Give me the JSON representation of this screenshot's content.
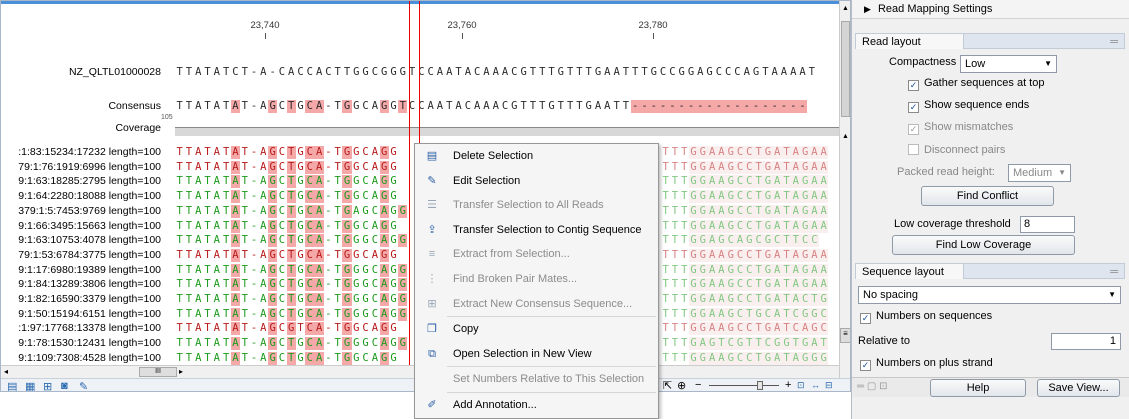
{
  "ruler": {
    "ticks": [
      "23,740",
      "23,760",
      "23,780"
    ]
  },
  "reference": {
    "name": "NZ_QLTL01000028",
    "bases": "TTATATCT-A-CACCACTTGGCGGGTCCAATACAAACGTTTGTTTGAATTTGCCGGAGCCCAGTAAAAT"
  },
  "consensus": {
    "label": "Consensus",
    "bases": "TTATATAT-AGCTGCA-TGGCAGGTCCAATACAAACGTTTGTTTGAATT-------------------"
  },
  "coverage": {
    "label": "Coverage",
    "max": "105"
  },
  "reads": [
    {
      "name": ":1:83:15234:17232 length=100",
      "left": "TTATATAT-AGCTGCA-TGGCAGG",
      "right": "TTTGGAAGCCTGATAGAA",
      "color": "#b81b1b"
    },
    {
      "name": "79:1:76:1919:6996 length=100",
      "left": "TTATATAT-AGCTGCA-TGGCAGG",
      "right": "TTTGGAAGCCTGATAGAA",
      "color": "#b81b1b"
    },
    {
      "name": "9:1:63:18285:2795 length=100",
      "left": "TTATATAT-AGCTGCA-TGGCAGG",
      "right": "TTTGGAAGCCTGATAGAA",
      "color": "#1c9b1c"
    },
    {
      "name": "9:1:64:2280:18088 length=100",
      "left": "TTATATAT-AGCTGCA-TGGCAGG",
      "right": "TTTGGAAGCCTGATAGAA",
      "color": "#1c9b1c"
    },
    {
      "name": "379:1:5:7453:9769 length=100",
      "left": "TTATATAT-AGCTGCA-TGAGCAGG",
      "right": "TTTGGAAGCCTGATAGAA",
      "color": "#1c9b1c"
    },
    {
      "name": "9:1:66:3495:15663 length=100",
      "left": "TTATATAT-AGCTGCA-TGGCAGG",
      "right": "TTTGGAAGCCTGATAGAA",
      "color": "#1c9b1c"
    },
    {
      "name": "9:1:63:10753:4078 length=100",
      "left": "TTATATAT-AGCTGCA-TGGGCAGG",
      "right": "TTTGGAGCAGCGCTTCC",
      "color": "#1c9b1c"
    },
    {
      "name": "79:1:53:6784:3775 length=100",
      "left": "TTATATAT-AGCTGCA-TGGCAGG",
      "right": "TTTGGAAGCCTGATAGAA",
      "color": "#b81b1b"
    },
    {
      "name": "9:1:17:6980:19389 length=100",
      "left": "TTATATAT-AGCTGCA-TGGGCAGG",
      "right": "TTTGGAAGCCTGATAGAA",
      "color": "#1c9b1c"
    },
    {
      "name": "9:1:84:13289:3806 length=100",
      "left": "TTATATAT-AGCTGCA-TGGGCAGG",
      "right": "TTTGGAAGCCTGATAGAA",
      "color": "#1c9b1c"
    },
    {
      "name": "9:1:82:16590:3379 length=100",
      "left": "TTATATAT-AGCTGCA-TGGGCAGG",
      "right": "TTTGGAAGCCTGATACTG",
      "color": "#1c9b1c"
    },
    {
      "name": "9:1:50:15194:6151 length=100",
      "left": "TTATATAT-AGCTGCA-TGGGCAGG",
      "right": "TTTGGAAGCTGCATCGGC",
      "color": "#1c9b1c"
    },
    {
      "name": ":1:97:17768:13378 length=100",
      "left": "TTATATAT-AGCGTCA-TGGCAGG",
      "right": "TTTGGAAGCCTGATCAGC",
      "color": "#b81b1b"
    },
    {
      "name": "9:1:78:1530:12431 length=100",
      "left": "TTATATAT-AGCTGCA-TGGGCAGG",
      "right": "TTTGAGTCGTTCGGTGAT",
      "color": "#1c9b1c"
    },
    {
      "name": "9:1:109:7308:4528 length=100",
      "left": "TTATATAT-AGCTGCA-TGGCAGG",
      "right": "TTTGGAAGCCTGATAGGG",
      "color": "#1c9b1c"
    }
  ],
  "context_menu": [
    {
      "label": "Delete Selection",
      "icon": "delete-selection-icon",
      "glyph": "▤",
      "enabled": true
    },
    {
      "label": "Edit Selection",
      "icon": "edit-pencil-icon",
      "glyph": "✎",
      "enabled": true
    },
    {
      "label": "Transfer Selection to All Reads",
      "icon": "transfer-all-icon",
      "glyph": "☰",
      "enabled": false
    },
    {
      "label": "Transfer Selection to Contig Sequence",
      "icon": "transfer-contig-icon",
      "glyph": "⇪",
      "enabled": true
    },
    {
      "label": "Extract from Selection...",
      "icon": "extract-icon",
      "glyph": "≡",
      "enabled": false
    },
    {
      "label": "Find Broken Pair Mates...",
      "icon": "broken-pair-icon",
      "glyph": "⋮",
      "enabled": false
    },
    {
      "label": "Extract New Consensus Sequence...",
      "icon": "consensus-icon",
      "glyph": "⊞",
      "enabled": false
    },
    {
      "label": "Copy",
      "icon": "copy-icon",
      "glyph": "❐",
      "enabled": true
    },
    {
      "label": "Open Selection in New View",
      "icon": "new-view-icon",
      "glyph": "⧉",
      "enabled": true
    },
    {
      "label": "Set Numbers Relative to This Selection",
      "icon": "",
      "glyph": "",
      "enabled": false
    },
    {
      "label": "Add Annotation...",
      "icon": "add-annotation-icon",
      "glyph": "✐",
      "enabled": true
    }
  ],
  "panel": {
    "title": "Read Mapping Settings",
    "read_layout": {
      "header": "Read layout",
      "compactness_label": "Compactness",
      "compactness_value": "Low",
      "gather_sequences": "Gather sequences at top",
      "show_sequence_ends": "Show sequence ends",
      "show_mismatches": "Show mismatches",
      "disconnect_pairs": "Disconnect pairs",
      "packed_read_height_label": "Packed read height:",
      "packed_read_height_value": "Medium",
      "find_conflict": "Find Conflict",
      "low_coverage_label": "Low coverage threshold",
      "low_coverage_value": "8",
      "find_low_coverage": "Find Low Coverage"
    },
    "sequence_layout": {
      "header": "Sequence layout",
      "spacing_value": "No spacing",
      "numbers_on_sequences": "Numbers on sequences",
      "relative_to_label": "Relative to",
      "relative_to_value": "1",
      "numbers_on_plus_strand": "Numbers on plus strand"
    },
    "help_button": "Help",
    "save_view_button": "Save View..."
  },
  "colors": {
    "accent_blue": "#4a90d9",
    "selection_red": "#e00000",
    "mismatch_bg": "#f5a8a8"
  }
}
